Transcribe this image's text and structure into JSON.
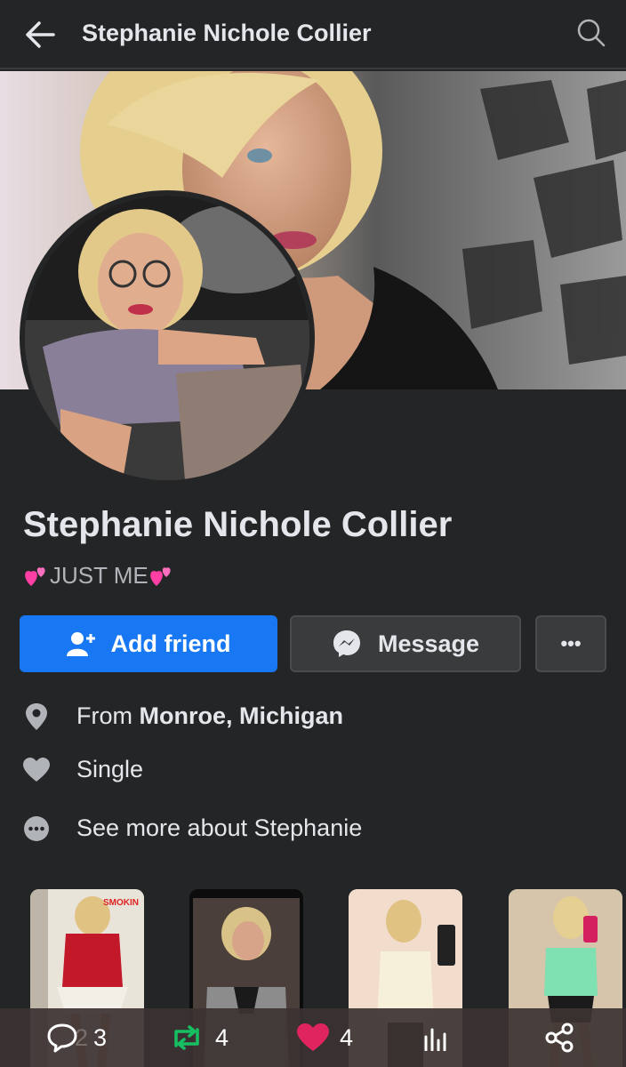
{
  "header": {
    "title": "Stephanie Nichole Collier"
  },
  "profile": {
    "name": "Stephanie Nichole Collier",
    "bio_text": "JUST ME"
  },
  "actions": {
    "add_friend_label": "Add friend",
    "message_label": "Message",
    "more_label": "•••"
  },
  "info": {
    "from_prefix": "From ",
    "from_value": "Monroe, Michigan",
    "relationship": "Single",
    "see_more": "See more about Stephanie"
  },
  "photos": [
    {
      "caption": "SMOKIN"
    }
  ],
  "bottom_bar": {
    "comments": "3",
    "comments_ghost": "2",
    "reposts": "4",
    "likes": "4"
  },
  "colors": {
    "background": "#242526",
    "primary": "#1877f2",
    "repost": "#17bf63",
    "like": "#e0245e"
  }
}
